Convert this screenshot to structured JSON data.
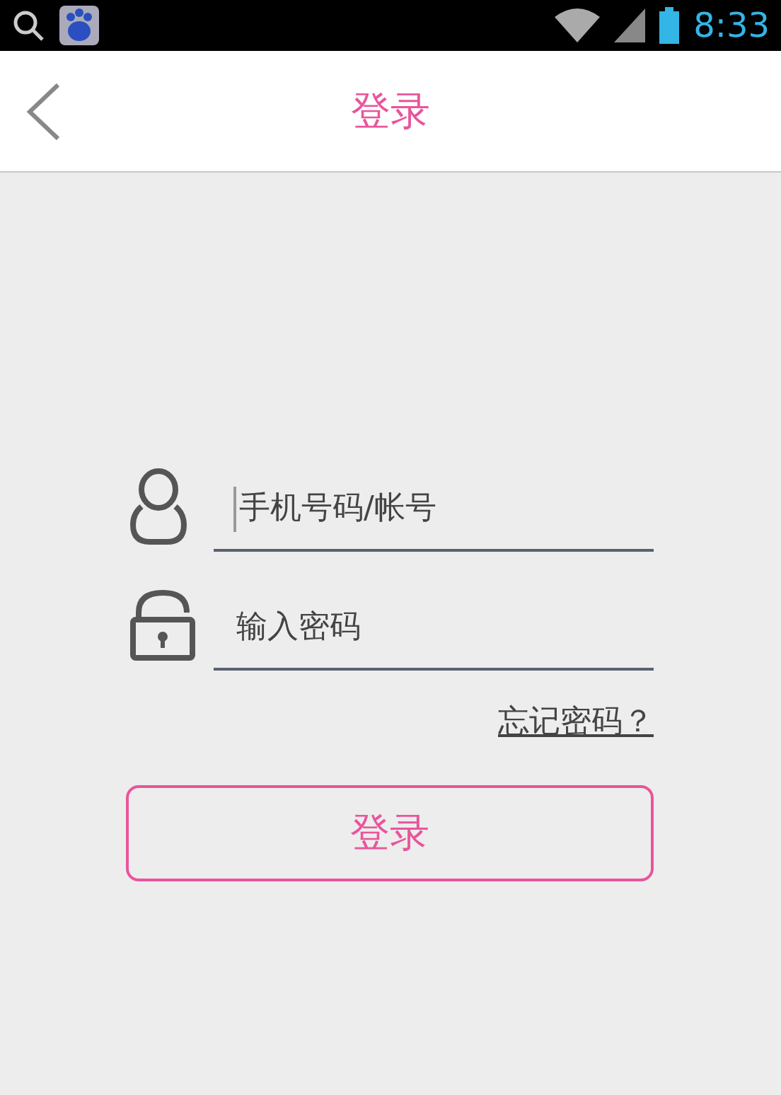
{
  "status_bar": {
    "time": "8:33"
  },
  "header": {
    "title": "登录"
  },
  "fields": [
    {
      "kind": "account",
      "placeholder": "手机号码/帐号",
      "focused": true
    },
    {
      "kind": "password",
      "placeholder": "输入密码",
      "focused": false
    }
  ],
  "forgot_link": "忘记密码？",
  "login_button": "登录"
}
